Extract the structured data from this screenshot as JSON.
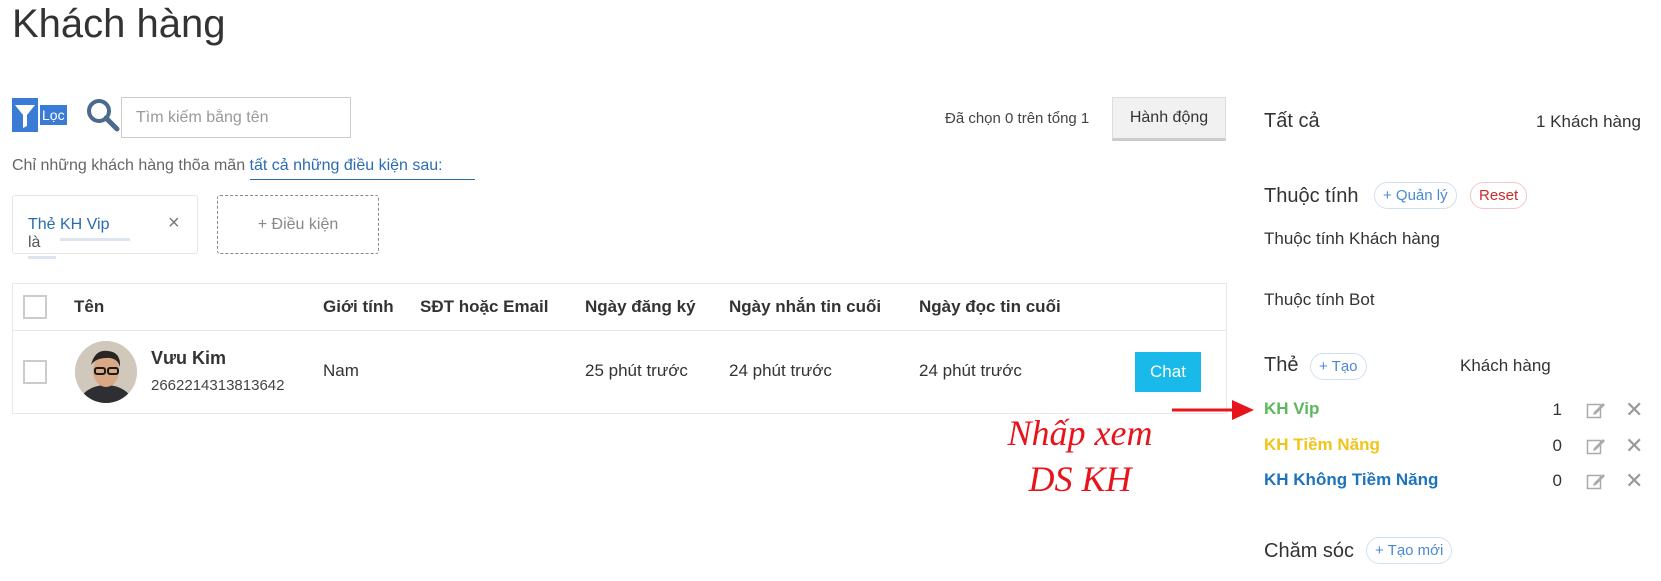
{
  "page": {
    "title": "Khách hàng"
  },
  "toolbar": {
    "filter_label": "Lọc",
    "search_placeholder": "Tìm kiếm bằng tên",
    "selected_text": "Đã chọn 0 trên tổng 1",
    "action_label": "Hành động"
  },
  "conditions": {
    "prefix": "Chỉ những khách hàng thõa mãn ",
    "link": "tất cả những điều kiện sau:",
    "chip": {
      "field": "Thẻ",
      "operator": "là",
      "value": "KH Vip",
      "close": "×"
    },
    "add_label": "+ Điều kiện"
  },
  "table": {
    "headers": {
      "name": "Tên",
      "gender": "Giới tính",
      "contact": "SĐT hoặc Email",
      "registered": "Ngày đăng ký",
      "last_message": "Ngày nhắn tin cuối",
      "last_read": "Ngày đọc tin cuối"
    },
    "rows": [
      {
        "name": "Vưu Kim",
        "id": "2662214313813642",
        "gender": "Nam",
        "contact": "",
        "registered": "25 phút trước",
        "last_message": "24 phút trước",
        "last_read": "24 phút trước",
        "chat_label": "Chat"
      }
    ]
  },
  "annotation": {
    "line1": "Nhấp xem",
    "line2": "DS KH",
    "color": "#e8141c"
  },
  "right_panel": {
    "all_label": "Tất cả",
    "all_count": "1 Khách hàng",
    "attributes": {
      "title": "Thuộc tính",
      "manage_label": "+ Quản lý",
      "reset_label": "Reset",
      "customer_attr": "Thuộc tính Khách hàng",
      "bot_attr": "Thuộc tính Bot"
    },
    "tags": {
      "title": "Thẻ",
      "create_label": "+ Tạo",
      "column_label": "Khách hàng",
      "items": [
        {
          "name": "KH Vip",
          "count": "1",
          "color": "#5cb85c"
        },
        {
          "name": "KH Tiềm Năng",
          "count": "0",
          "color": "#f0c419"
        },
        {
          "name": "KH Không Tiềm Năng",
          "count": "0",
          "color": "#1e73be"
        }
      ]
    },
    "care": {
      "title": "Chăm sóc",
      "create_label": "+ Tạo mới"
    }
  }
}
